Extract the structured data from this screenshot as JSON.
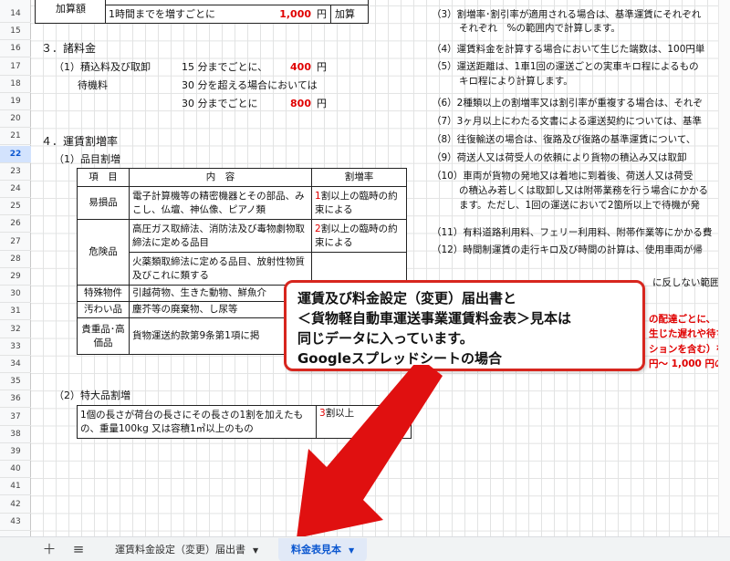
{
  "rows": [
    "14",
    "15",
    "16",
    "17",
    "18",
    "19",
    "20",
    "21",
    "22",
    "23",
    "24",
    "25",
    "26",
    "27",
    "28",
    "29",
    "30",
    "31",
    "32",
    "33",
    "34",
    "35",
    "36",
    "37",
    "38",
    "39",
    "40",
    "41",
    "42",
    "43"
  ],
  "active_row": "22",
  "left": {
    "kasan_label": "加算額",
    "kasan_text": "1時間までを増すごとに",
    "kasan_value": "1,000",
    "kasan_unit": "円",
    "kasan_suffix": "加算",
    "sec3_title": "３．諸料金",
    "sec3_item1": "（1）積込料及び取卸",
    "sec3_item1_text": "15 分までごとに、",
    "sec3_item1_value": "400",
    "sec3_item1_unit": "円",
    "sec3_wait_label": "待機料",
    "sec3_wait1_text": "30 分を超える場合においては",
    "sec3_wait2_text": "30 分までごとに",
    "sec3_wait2_value": "800",
    "sec3_wait2_unit": "円",
    "sec4_title": "４．運賃割増率",
    "sec4_sub1": "（1）品目割増",
    "sec4_sub2": "（2）特大品割増"
  },
  "item_table": {
    "headers": [
      "項　目",
      "内　容",
      "割増率"
    ],
    "rows": [
      {
        "item": "易損品",
        "content": "電子計算機等の精密機器とその部品、みこし、仏壇、神仏像、ピアノ類",
        "rate_num": "1",
        "rate_text": "割以上の臨時の約束による"
      },
      {
        "item": "危険品",
        "content": "高圧ガス取締法、消防法及び毒物劇物取締法に定める品目",
        "rate_num": "2",
        "rate_text": "割以上の臨時の約束による"
      },
      {
        "item": "",
        "content": "火薬類取締法に定める品目、放射性物質及びこれに類する",
        "rate_num": "",
        "rate_text": ""
      },
      {
        "item": "特殊物件",
        "content": "引越荷物、生きた動物、鮮魚介",
        "rate_num": "",
        "rate_text": ""
      },
      {
        "item": "汚わい品",
        "content": "塵芥等の廃棄物、し尿等",
        "rate_num": "",
        "rate_text": ""
      },
      {
        "item": "貴重品･高価品",
        "content": "貨物運送約款第9条第1項に掲",
        "rate_num": "",
        "rate_text": ""
      }
    ]
  },
  "special_table": {
    "content": "1個の長さが荷台の長さにその長さの1割を加えたもの、重量100kg 又は容積1㎥以上のもの",
    "rate_num": "3",
    "rate_text": "割以上"
  },
  "right": {
    "n3": "（3）割増率･割引率が適用される場合は、基準運賃にそれぞれ",
    "n3b": "それぞれ　%の範囲内で計算します。",
    "n4": "（4）運賃料金を計算する場合において生じた端数は、100円単",
    "n5": "（5）運送距離は、1車1回の運送ごとの実車キロ程によるもの",
    "n5b": "キロ程により計算します。",
    "n6": "（6）2種類以上の割増率又は割引率が重複する場合は、それぞ",
    "n7": "（7）3ヶ月以上にわたる文書による運送契約については、基準",
    "n8": "（8）往復輸送の場合は、復路及び復路の基準運賃について、",
    "n9": "（9）荷送人又は荷受人の依頼により貨物の積込み又は取卸",
    "n10": "（10）車両が貨物の発地又は着地に到着後、荷送人又は荷受",
    "n10b": "の積込み若しくは取卸し又は附帯業務を行う場合にかかる",
    "n10c": "ます。ただし、1回の運送において2箇所以上で待機が発",
    "n11": "（11）有料道路利用料、フェリー利用料、附帯作業等にかかる費",
    "n12": "（12）時間制運賃の走行キロ及び時間の計算は、使用車両が帰",
    "n12b": "に反しない範囲",
    "red1": "の配達ごとに、",
    "red2": "生じた遅れや待ち",
    "red3": "ションを含む）を含",
    "red4": "円～ 1,000 円の"
  },
  "callout": {
    "line1": "運賃及び料金設定（変更）届出書と",
    "line2": "＜貨物軽自動車運送事業運賃料金表＞見本は",
    "line3": "同じデータに入っています。",
    "line4": "Googleスプレッドシートの場合"
  },
  "tabbar": {
    "add_icon": "＋",
    "menu_icon": "≡",
    "tab1": "運賃料金設定（変更）届出書",
    "tab2": "料金表見本",
    "caret": "▼"
  },
  "colors": {
    "accent_red": "#e00000",
    "callout_border": "#d7261e",
    "active_tab": "#0b57d0"
  }
}
